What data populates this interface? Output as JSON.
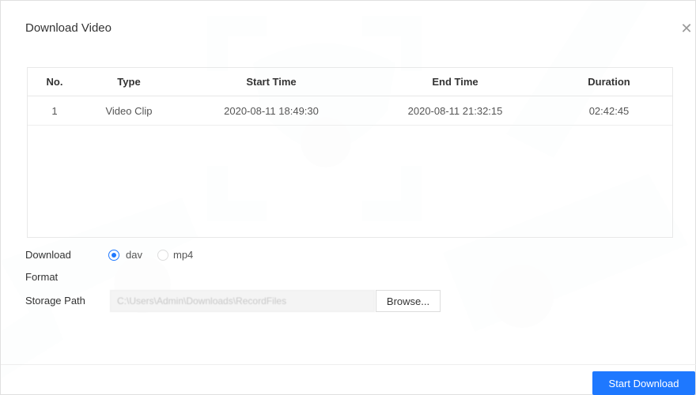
{
  "dialog": {
    "title": "Download Video"
  },
  "table": {
    "columns": [
      "No.",
      "Type",
      "Start Time",
      "End Time",
      "Duration"
    ],
    "rows": [
      {
        "no": "1",
        "type": "Video Clip",
        "start": "2020-08-11 18:49:30",
        "end": "2020-08-11 21:32:15",
        "duration": "02:42:45"
      }
    ]
  },
  "form": {
    "download_format_label_line1": "Download",
    "download_format_label_line2": "Format",
    "format_options": [
      "dav",
      "mp4"
    ],
    "selected_format": "dav",
    "storage_path_label": "Storage Path",
    "storage_path_value": "C:\\Users\\Admin\\Downloads\\RecordFiles",
    "browse_label": "Browse..."
  },
  "footer": {
    "start_label": "Start Download"
  },
  "colors": {
    "accent": "#1e78ff"
  }
}
